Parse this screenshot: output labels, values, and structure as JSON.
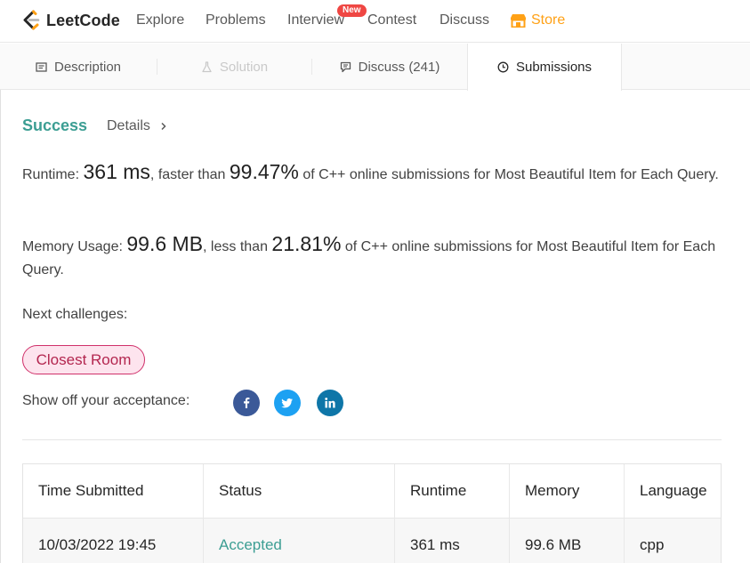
{
  "brand": {
    "name": "LeetCode"
  },
  "nav": {
    "explore": "Explore",
    "problems": "Problems",
    "interview": "Interview",
    "new_badge": "New",
    "contest": "Contest",
    "discuss": "Discuss",
    "store": "Store"
  },
  "tabs": {
    "description": "Description",
    "solution": "Solution",
    "discuss": "Discuss (241)",
    "submissions": "Submissions"
  },
  "result": {
    "status": "Success",
    "details": "Details"
  },
  "runtime": {
    "label": "Runtime:",
    "value": "361 ms",
    "comparison": ", faster than",
    "percent": "99.47%",
    "suffix": "of C++ online submissions for Most Beautiful Item for Each Query."
  },
  "memory": {
    "label": "Memory Usage:",
    "value": "99.6 MB",
    "comparison": ", less than",
    "percent": "21.81%",
    "suffix": "of C++ online submissions for Most Beautiful Item for Each Query."
  },
  "next": {
    "label": "Next challenges:",
    "challenge": "Closest Room"
  },
  "share": {
    "label": "Show off your acceptance:",
    "icons": [
      "facebook-icon",
      "twitter-icon",
      "linkedin-icon"
    ]
  },
  "table": {
    "headers": [
      "Time Submitted",
      "Status",
      "Runtime",
      "Memory",
      "Language"
    ],
    "rows": [
      [
        "10/03/2022 19:45",
        "Accepted",
        "361 ms",
        "99.6 MB",
        "cpp"
      ]
    ]
  },
  "colors": {
    "accent_orange": "#ffa116",
    "success_teal": "#3c9e93",
    "challenge_pink": "#fde4ee",
    "facebook": "#3b5998",
    "twitter": "#1da1f2",
    "linkedin": "#0e76a8"
  }
}
